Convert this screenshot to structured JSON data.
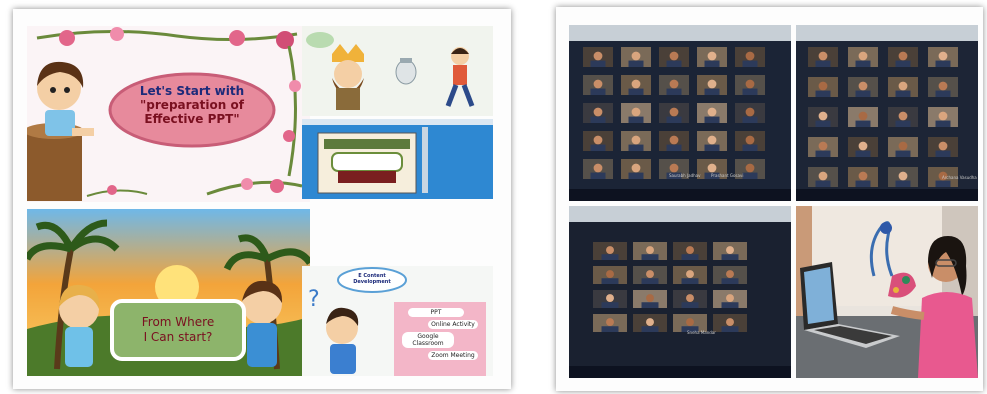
{
  "left_collage": {
    "slide_intro": {
      "title_line1": "Let's Start with",
      "title_line2": "\"preparation of",
      "title_line3": "Effective PPT\""
    },
    "slide_question": {
      "text_line1": "From Where",
      "text_line2": "I Can start?"
    },
    "slide_tools": {
      "header": "E Content Development",
      "items": [
        "PPT",
        "Online Activity",
        "Google Classroom",
        "Zoom Meeting"
      ]
    }
  },
  "right_collage": {
    "meeting_captions": [
      "Saurabh Jadhav",
      "Prashant Gosavi",
      "Sneha Mandar",
      "Archana Vasudha"
    ]
  },
  "colors": {
    "title_oval": "#e78a9c",
    "title_text": "#1c2a7a",
    "green_board": "#8db46b",
    "sky_orange": "#f3a43a",
    "meeting_bg": "#1b2436"
  }
}
